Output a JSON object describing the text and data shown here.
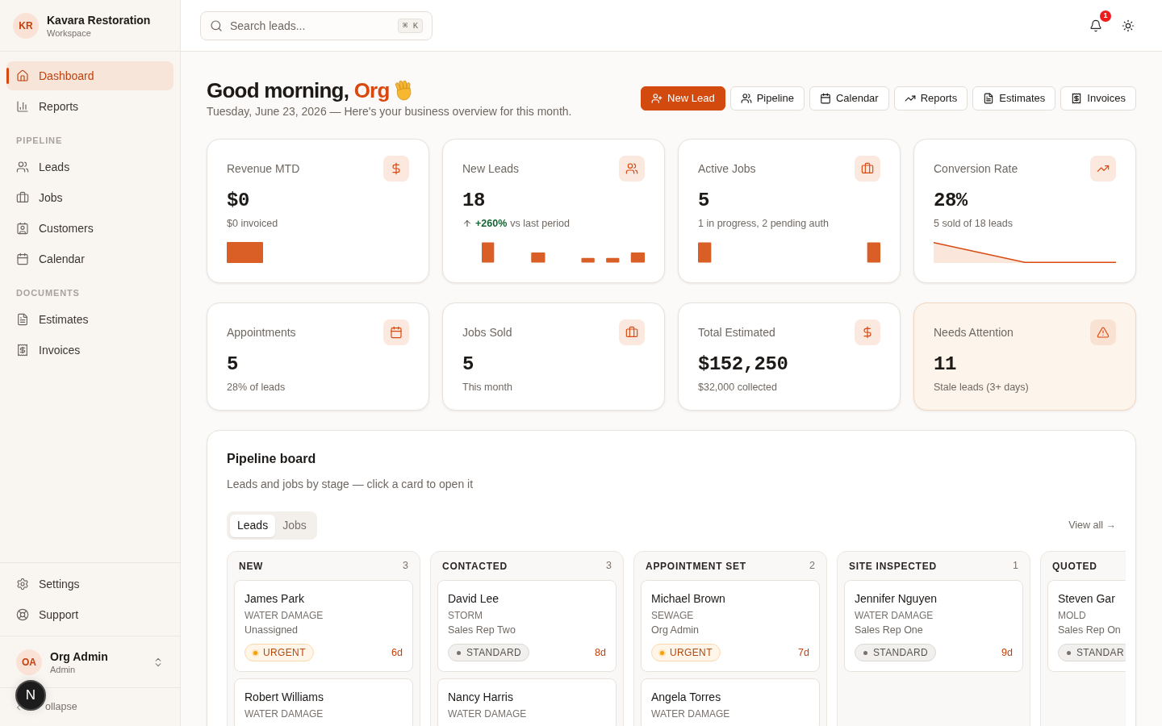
{
  "sidebar": {
    "workspace": {
      "initials": "KR",
      "name": "Kavara Restoration",
      "subtitle": "Workspace"
    },
    "sections": [
      {
        "items": [
          {
            "label": "Dashboard",
            "selected": true
          },
          {
            "label": "Reports",
            "selected": false
          }
        ]
      },
      {
        "heading": "PIPELINE",
        "items": [
          {
            "label": "Leads",
            "selected": false
          },
          {
            "label": "Jobs",
            "selected": false
          },
          {
            "label": "Customers",
            "selected": false
          },
          {
            "label": "Calendar",
            "selected": false
          }
        ]
      },
      {
        "heading": "DOCUMENTS",
        "items": [
          {
            "label": "Estimates",
            "selected": false
          },
          {
            "label": "Invoices",
            "selected": false
          }
        ]
      }
    ],
    "footer_items": [
      {
        "label": "Settings",
        "selected": false
      },
      {
        "label": "Support",
        "selected": false
      }
    ],
    "user": {
      "initials": "OA",
      "name": "Org Admin",
      "role": "Admin"
    },
    "collapse": {
      "label": "ollapse"
    }
  },
  "dev_tools": {
    "label": "N"
  },
  "header": {
    "search": {
      "placeholder": "Search leads...",
      "shortcut": "⌘ K"
    },
    "notifications": {
      "count": "1"
    }
  },
  "greeting": {
    "salutation": "Good morning,",
    "name": "Org",
    "subtitle": "Tuesday, June 23, 2026 — Here's your business overview for this month."
  },
  "quick_actions": [
    {
      "label": "New Lead",
      "primary": true
    },
    {
      "label": "Pipeline",
      "primary": false
    },
    {
      "label": "Calendar",
      "primary": false
    },
    {
      "label": "Reports",
      "primary": false
    },
    {
      "label": "Estimates",
      "primary": false
    },
    {
      "label": "Invoices",
      "primary": false
    }
  ],
  "stats": [
    {
      "title": "Revenue MTD",
      "value": "$0",
      "note": "$0 invoiced",
      "alert": false
    },
    {
      "title": "New Leads",
      "value": "18",
      "trend": "+260%",
      "note": "vs last period",
      "alert": false
    },
    {
      "title": "Active Jobs",
      "value": "5",
      "note": "1 in progress, 2 pending auth",
      "alert": false
    },
    {
      "title": "Conversion Rate",
      "value": "28%",
      "note": "5 sold of 18 leads",
      "alert": false
    },
    {
      "title": "Appointments",
      "value": "5",
      "note": "28% of leads",
      "alert": false
    },
    {
      "title": "Jobs Sold",
      "value": "5",
      "note": "This month",
      "alert": false
    },
    {
      "title": "Total Estimated",
      "value": "$152,250",
      "note": "$32,000 collected",
      "alert": false
    },
    {
      "title": "Needs Attention",
      "value": "11",
      "note": "Stale leads (3+ days)",
      "alert": true
    }
  ],
  "pipeline_board": {
    "title": "Pipeline board",
    "subtitle": "Leads and jobs by stage — click a card to open it",
    "tabs": [
      {
        "label": "Leads",
        "selected": true
      },
      {
        "label": "Jobs",
        "selected": false
      }
    ],
    "view_all": "View all →",
    "columns": [
      {
        "stage": "NEW",
        "count": "3",
        "cards": [
          {
            "name": "James Park",
            "type": "WATER DAMAGE",
            "assignee": "Unassigned",
            "badge": {
              "label": "URGENT",
              "kind": "urgent"
            },
            "age": "6d"
          },
          {
            "name": "Robert Williams",
            "type": "WATER DAMAGE"
          }
        ]
      },
      {
        "stage": "CONTACTED",
        "count": "3",
        "cards": [
          {
            "name": "David Lee",
            "type": "STORM",
            "assignee": "Sales Rep Two",
            "badge": {
              "label": "STANDARD",
              "kind": "standard"
            },
            "age": "8d"
          },
          {
            "name": "Nancy Harris",
            "type": "WATER DAMAGE"
          }
        ]
      },
      {
        "stage": "APPOINTMENT SET",
        "count": "2",
        "cards": [
          {
            "name": "Michael Brown",
            "type": "SEWAGE",
            "assignee": "Org Admin",
            "badge": {
              "label": "URGENT",
              "kind": "urgent"
            },
            "age": "7d"
          },
          {
            "name": "Angela Torres",
            "type": "WATER DAMAGE"
          }
        ]
      },
      {
        "stage": "SITE INSPECTED",
        "count": "1",
        "cards": [
          {
            "name": "Jennifer Nguyen",
            "type": "WATER DAMAGE",
            "assignee": "Sales Rep One",
            "badge": {
              "label": "STANDARD",
              "kind": "standard"
            },
            "age": "9d"
          }
        ]
      },
      {
        "stage": "QUOTED",
        "cards": [
          {
            "name": "Steven Gar",
            "type": "MOLD",
            "assignee": "Sales Rep On",
            "badge": {
              "label": "STANDAR",
              "kind": "standard"
            }
          }
        ]
      }
    ]
  }
}
